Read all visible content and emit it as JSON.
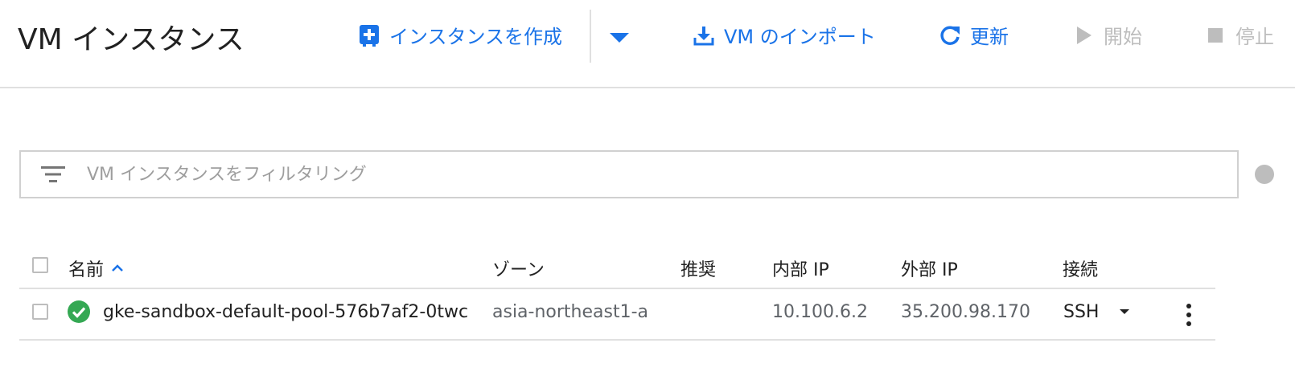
{
  "header": {
    "title": "VM インスタンス",
    "actions": {
      "create": "インスタンスを作成",
      "import": "VM のインポート",
      "refresh": "更新",
      "start": "開始",
      "stop": "停止"
    }
  },
  "filter": {
    "placeholder": "VM インスタンスをフィルタリング"
  },
  "table": {
    "columns": {
      "name": "名前",
      "zone": "ゾーン",
      "recommendation": "推奨",
      "internal_ip": "内部 IP",
      "external_ip": "外部 IP",
      "connect": "接続"
    },
    "rows": [
      {
        "status": "running",
        "name": "gke-sandbox-default-pool-576b7af2-0twc",
        "zone": "asia-northeast1-a",
        "recommendation": "",
        "internal_ip": "10.100.6.2",
        "external_ip": "35.200.98.170",
        "connect": "SSH"
      }
    ]
  },
  "colors": {
    "accent": "#1a73e8",
    "disabled": "#bdbdbd",
    "status_ok": "#34a853"
  },
  "icons": [
    "add-box-icon",
    "chevron-down-icon",
    "download-icon",
    "refresh-icon",
    "play-icon",
    "stop-icon",
    "filter-icon",
    "sort-asc-icon",
    "check-circle-icon",
    "more-vert-icon"
  ]
}
